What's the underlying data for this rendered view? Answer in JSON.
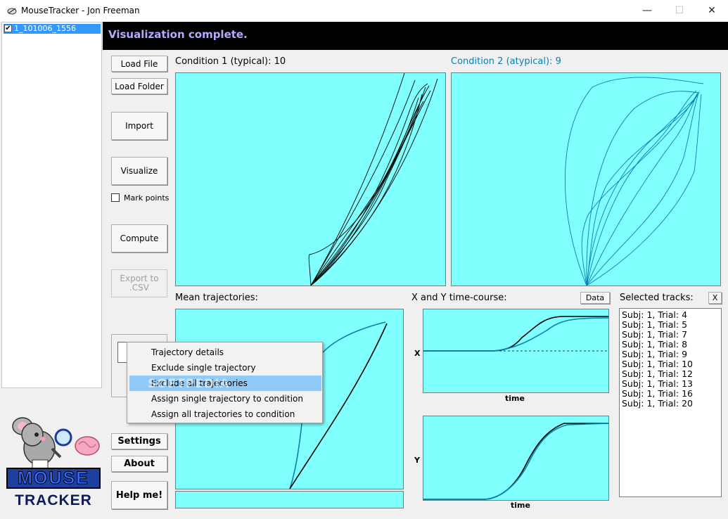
{
  "window": {
    "title": "MouseTracker - Jon Freeman",
    "minimize": "—",
    "maximize": "☐",
    "close": "✕"
  },
  "file_list": {
    "items": [
      {
        "label": "1_101006_1556",
        "checked": "✔"
      }
    ]
  },
  "status": {
    "text": "Visualization complete."
  },
  "buttons": {
    "load_file": "Load File",
    "load_folder": "Load Folder",
    "import": "Import",
    "visualize": "Visualize",
    "mark_points": "Mark points",
    "compute": "Compute",
    "export_line1": "Export to",
    "export_line2": ".CSV",
    "settings": "Settings",
    "about": "About",
    "help": "Help me!",
    "data": "Data",
    "clear_tracks": "X"
  },
  "labels": {
    "condition1": "Condition 1 (typical): 10",
    "condition2": "Condition 2 (atypical): 9",
    "mean": "Mean trajectories:",
    "xy_timecourse": "X and Y time-course:",
    "selected_tracks": "Selected tracks:",
    "x_axis": "X",
    "y_axis": "Y",
    "time": "time"
  },
  "selected_tracks": [
    "Subj: 1, Trial: 4",
    "Subj: 1, Trial: 5",
    "Subj: 1, Trial: 7",
    "Subj: 1, Trial: 8",
    "Subj: 1, Trial: 9",
    "Subj: 1, Trial: 10",
    "Subj: 1, Trial: 12",
    "Subj: 1, Trial: 13",
    "Subj: 1, Trial: 16",
    "Subj: 1, Trial: 20"
  ],
  "context_menu": {
    "items": [
      {
        "label": "Trajectory details"
      },
      {
        "label": "Exclude single trajectory"
      },
      {
        "label": "Exclude all trajectories",
        "highlighted": true
      },
      {
        "label": "Assign single trajectory to condition"
      },
      {
        "label": "Assign all trajectories to condition"
      }
    ]
  },
  "watermark": "SOFTPEDIA",
  "logo": {
    "line1": "MOUSE",
    "line2": "TRACKER"
  },
  "colors": {
    "plot_bg": "#80ffff",
    "typical": "#000000",
    "atypical": "#0a7fb0",
    "status_text": "#b8a8ff",
    "menu_highlight": "#91c9f7"
  }
}
